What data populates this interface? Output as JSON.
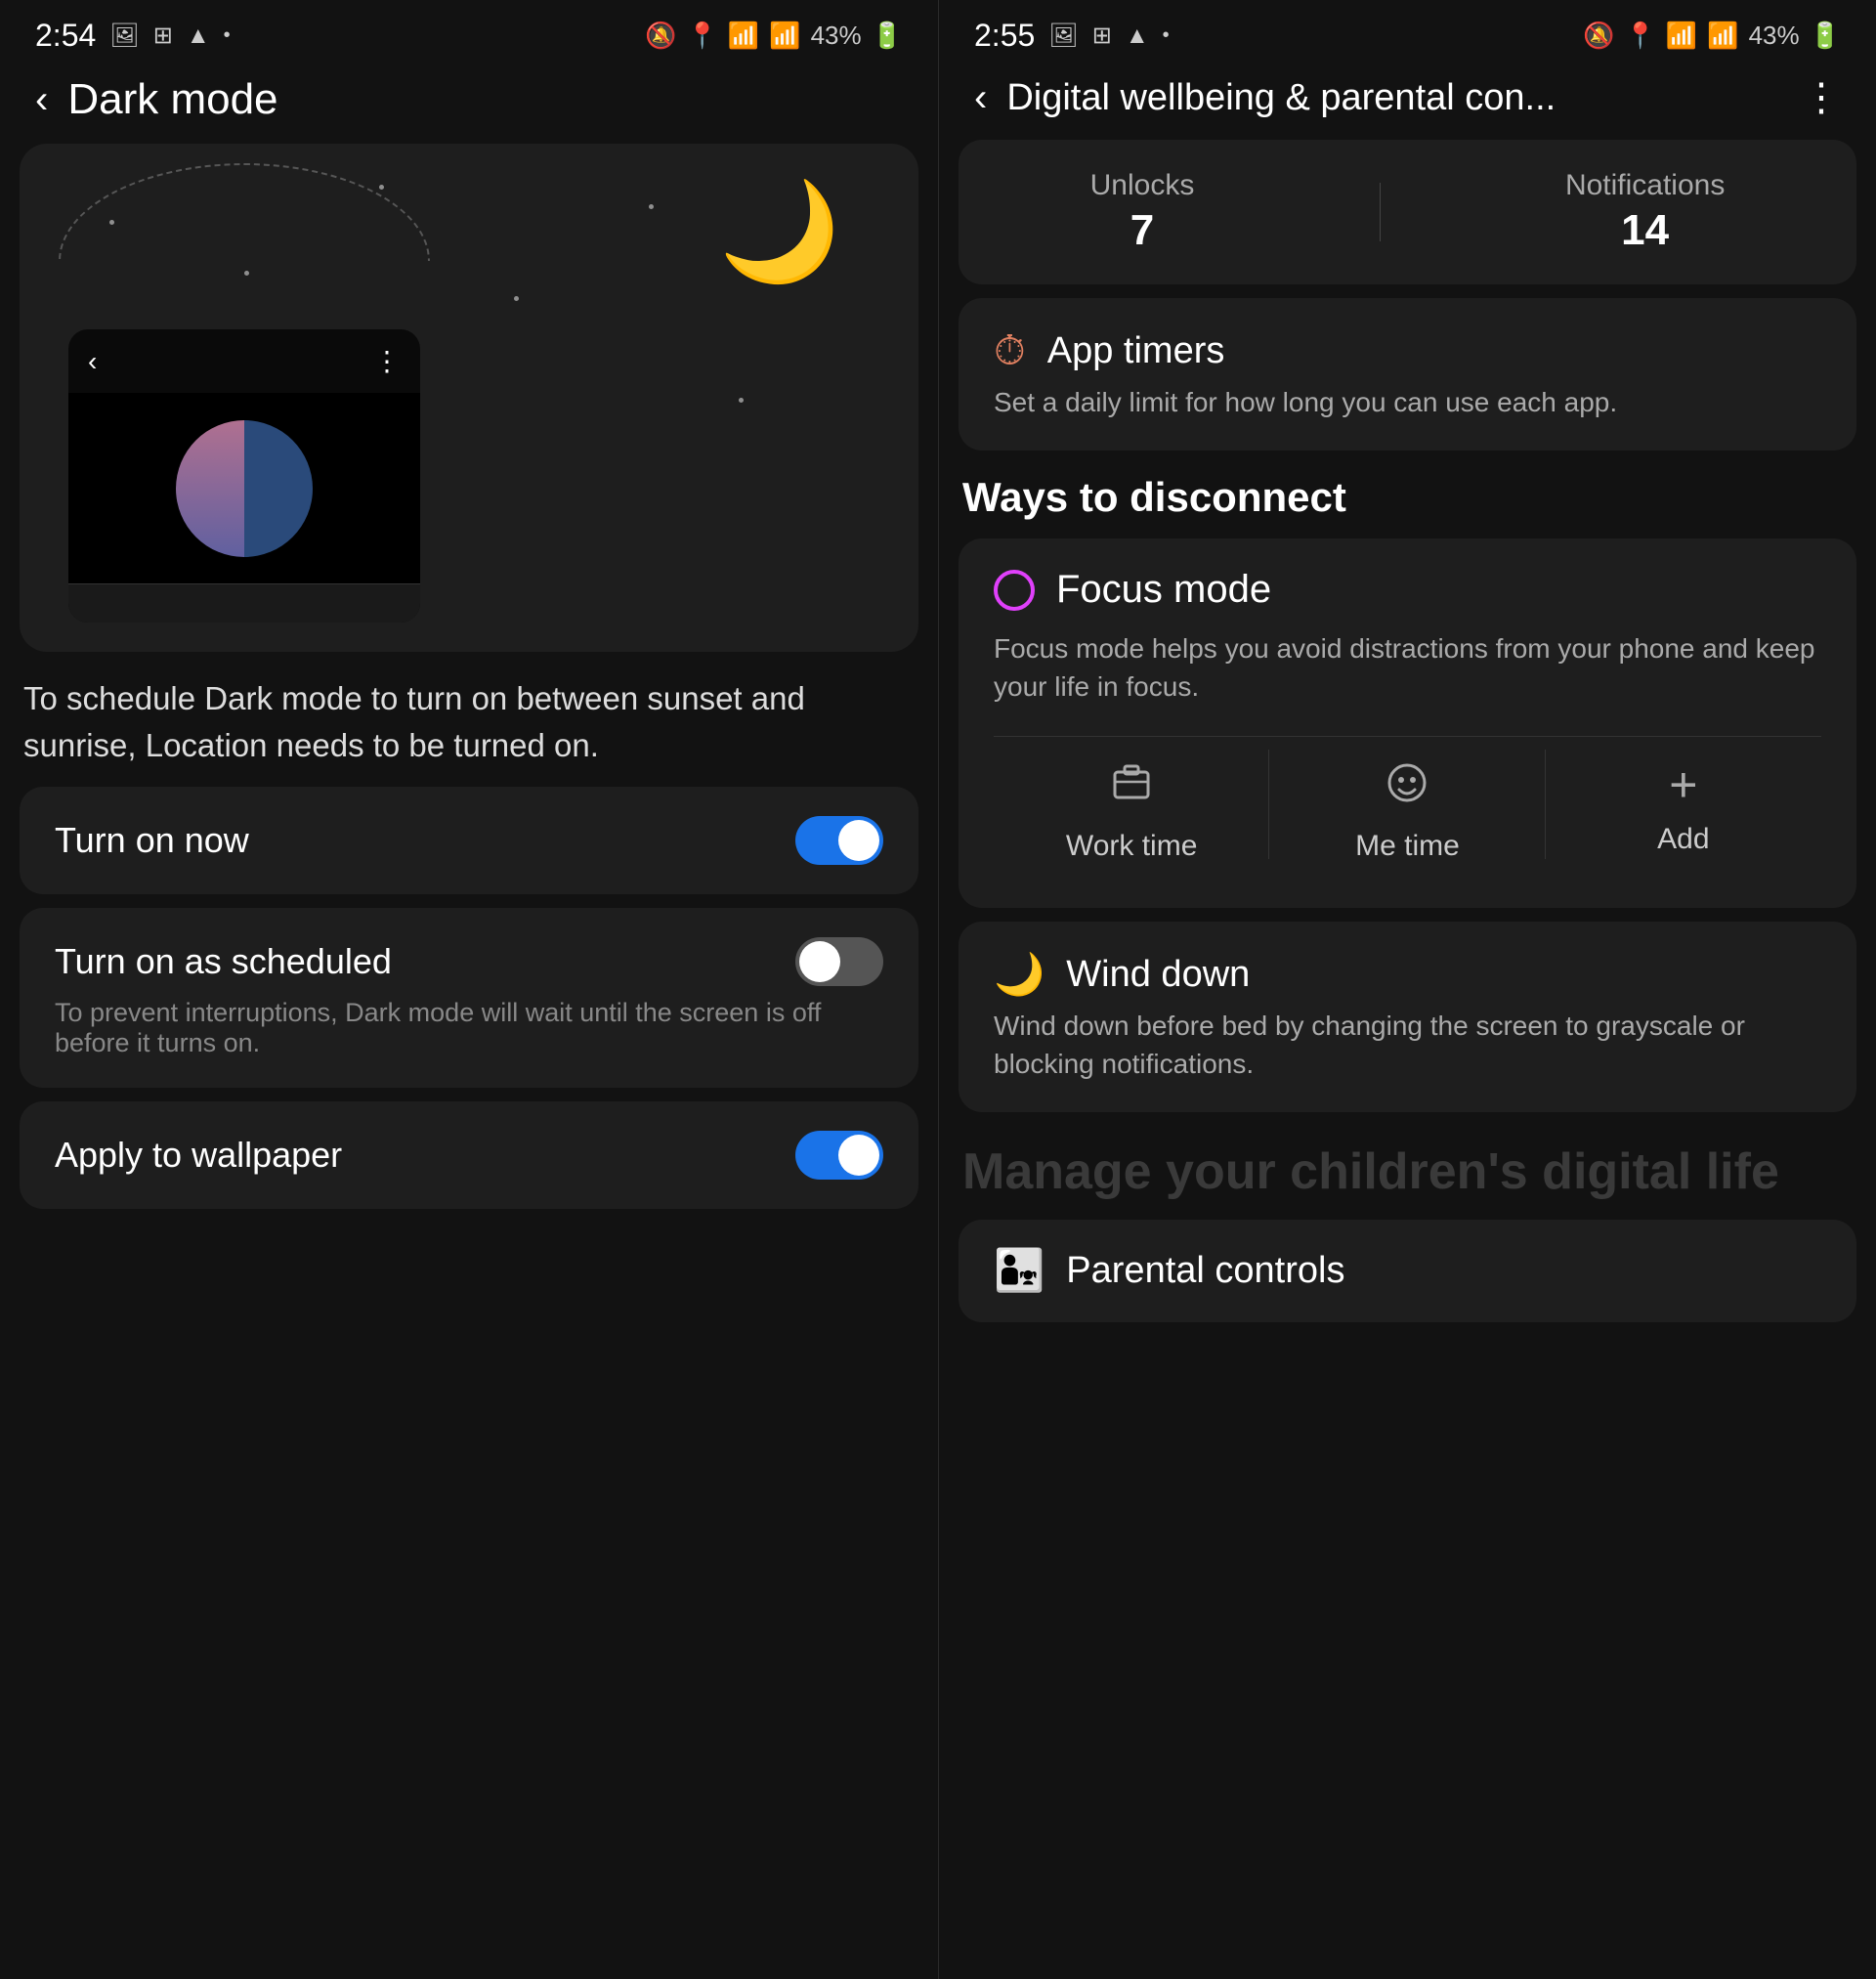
{
  "left": {
    "statusBar": {
      "time": "2:54",
      "battery": "43%"
    },
    "navTitle": "Dark mode",
    "description": "To schedule Dark mode to turn on between sunset and sunrise, Location needs to be turned on.",
    "settings": [
      {
        "id": "turn-on-now",
        "label": "Turn on now",
        "sub": null,
        "toggle": "on"
      },
      {
        "id": "turn-on-scheduled",
        "label": "Turn on as scheduled",
        "sub": "To prevent interruptions, Dark mode will wait until the screen is off before it turns on.",
        "toggle": "off"
      },
      {
        "id": "apply-wallpaper",
        "label": "Apply to wallpaper",
        "sub": null,
        "toggle": "on"
      }
    ]
  },
  "right": {
    "statusBar": {
      "time": "2:55",
      "battery": "43%"
    },
    "navTitle": "Digital wellbeing & parental con...",
    "stats": {
      "unlocks_label": "Unlocks",
      "unlocks_value": "7",
      "notifications_label": "Notifications",
      "notifications_value": "14"
    },
    "appTimers": {
      "icon": "⏱",
      "title": "App timers",
      "sub": "Set a daily limit for how long you can use each app."
    },
    "waysToDisconnect": "Ways to disconnect",
    "focusMode": {
      "title": "Focus mode",
      "sub": "Focus mode helps you avoid distractions from your phone and keep your life in focus.",
      "modes": [
        {
          "id": "work-time",
          "icon": "⊞",
          "label": "Work time"
        },
        {
          "id": "me-time",
          "icon": "☺",
          "label": "Me time"
        },
        {
          "id": "add",
          "icon": "+",
          "label": "Add"
        }
      ]
    },
    "windDown": {
      "icon": "🌙",
      "title": "Wind down",
      "sub": "Wind down before bed by changing the screen to grayscale or blocking notifications."
    },
    "manageHeading": "Manage your children's digital life",
    "parentalControls": {
      "icon": "👨‍👧",
      "title": "Parental controls"
    }
  }
}
